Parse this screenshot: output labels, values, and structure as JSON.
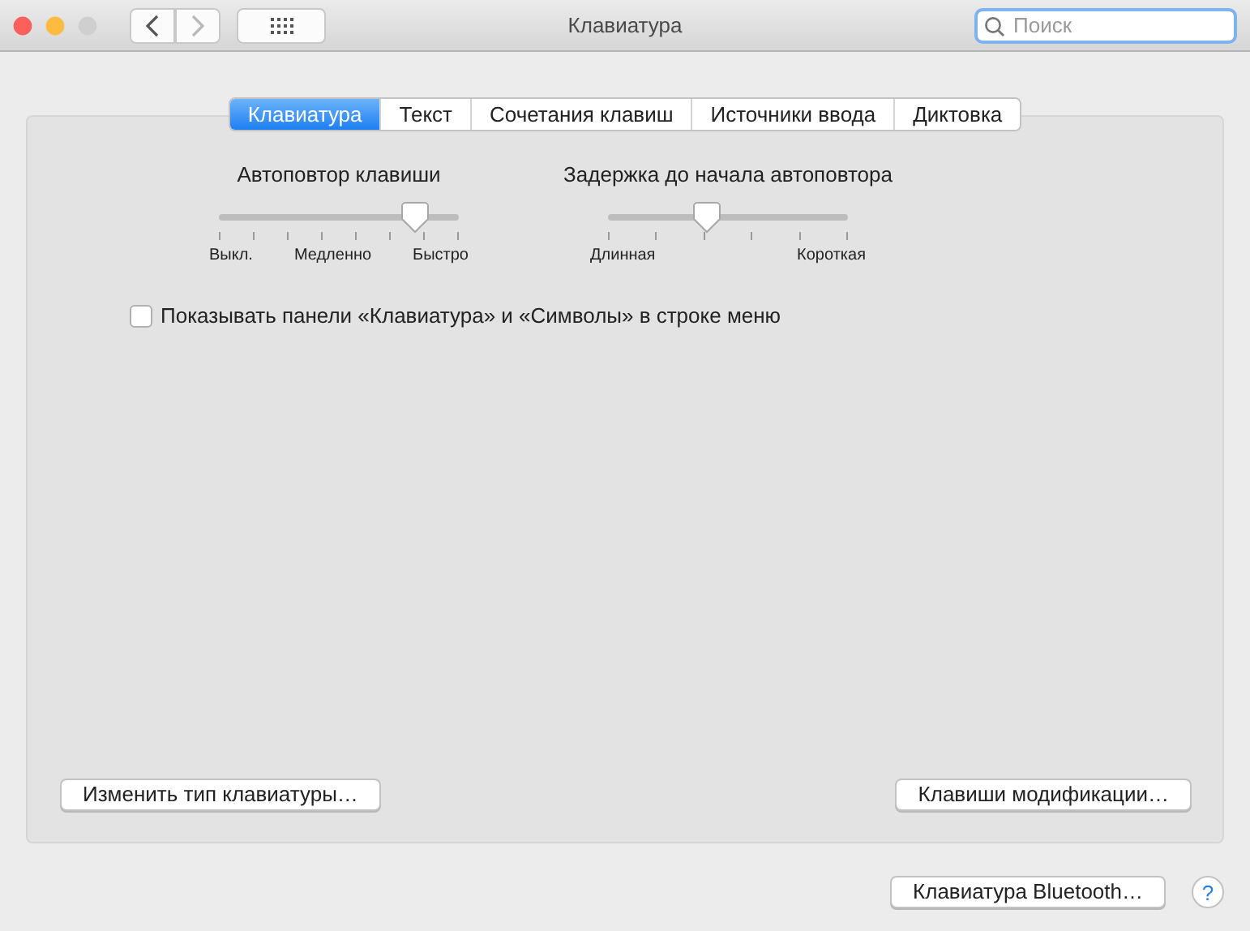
{
  "window": {
    "title": "Клавиатура"
  },
  "nav": [
    {
      "kind": "back",
      "disabled": false
    },
    {
      "kind": "forward",
      "disabled": true
    }
  ],
  "search": {
    "placeholder": "Поиск"
  },
  "tabs": [
    {
      "label": "Клавиатура",
      "selected": true
    },
    {
      "label": "Текст",
      "selected": false
    },
    {
      "label": "Сочетания клавиш",
      "selected": false
    },
    {
      "label": "Источники ввода",
      "selected": false
    },
    {
      "label": "Диктовка",
      "selected": false
    }
  ],
  "sliders": [
    {
      "title": "Автоповтор клавиши",
      "level": 0.82,
      "labels": [
        "Выкл.",
        "Медленно",
        "Быстро"
      ]
    },
    {
      "title": "Задержка до начала автоповтора",
      "level": 0.41,
      "labels": [
        "Длинная",
        "Короткая"
      ]
    }
  ],
  "checkbox": {
    "label": "Показывать панели «Клавиатура» и «Символы» в строке меню",
    "checked": false
  },
  "panel_buttons": [
    "Изменить тип клавиатуры…",
    "Клавиши модификации…"
  ],
  "footer_button": "Клавиатура Bluetooth…",
  "help": "?"
}
